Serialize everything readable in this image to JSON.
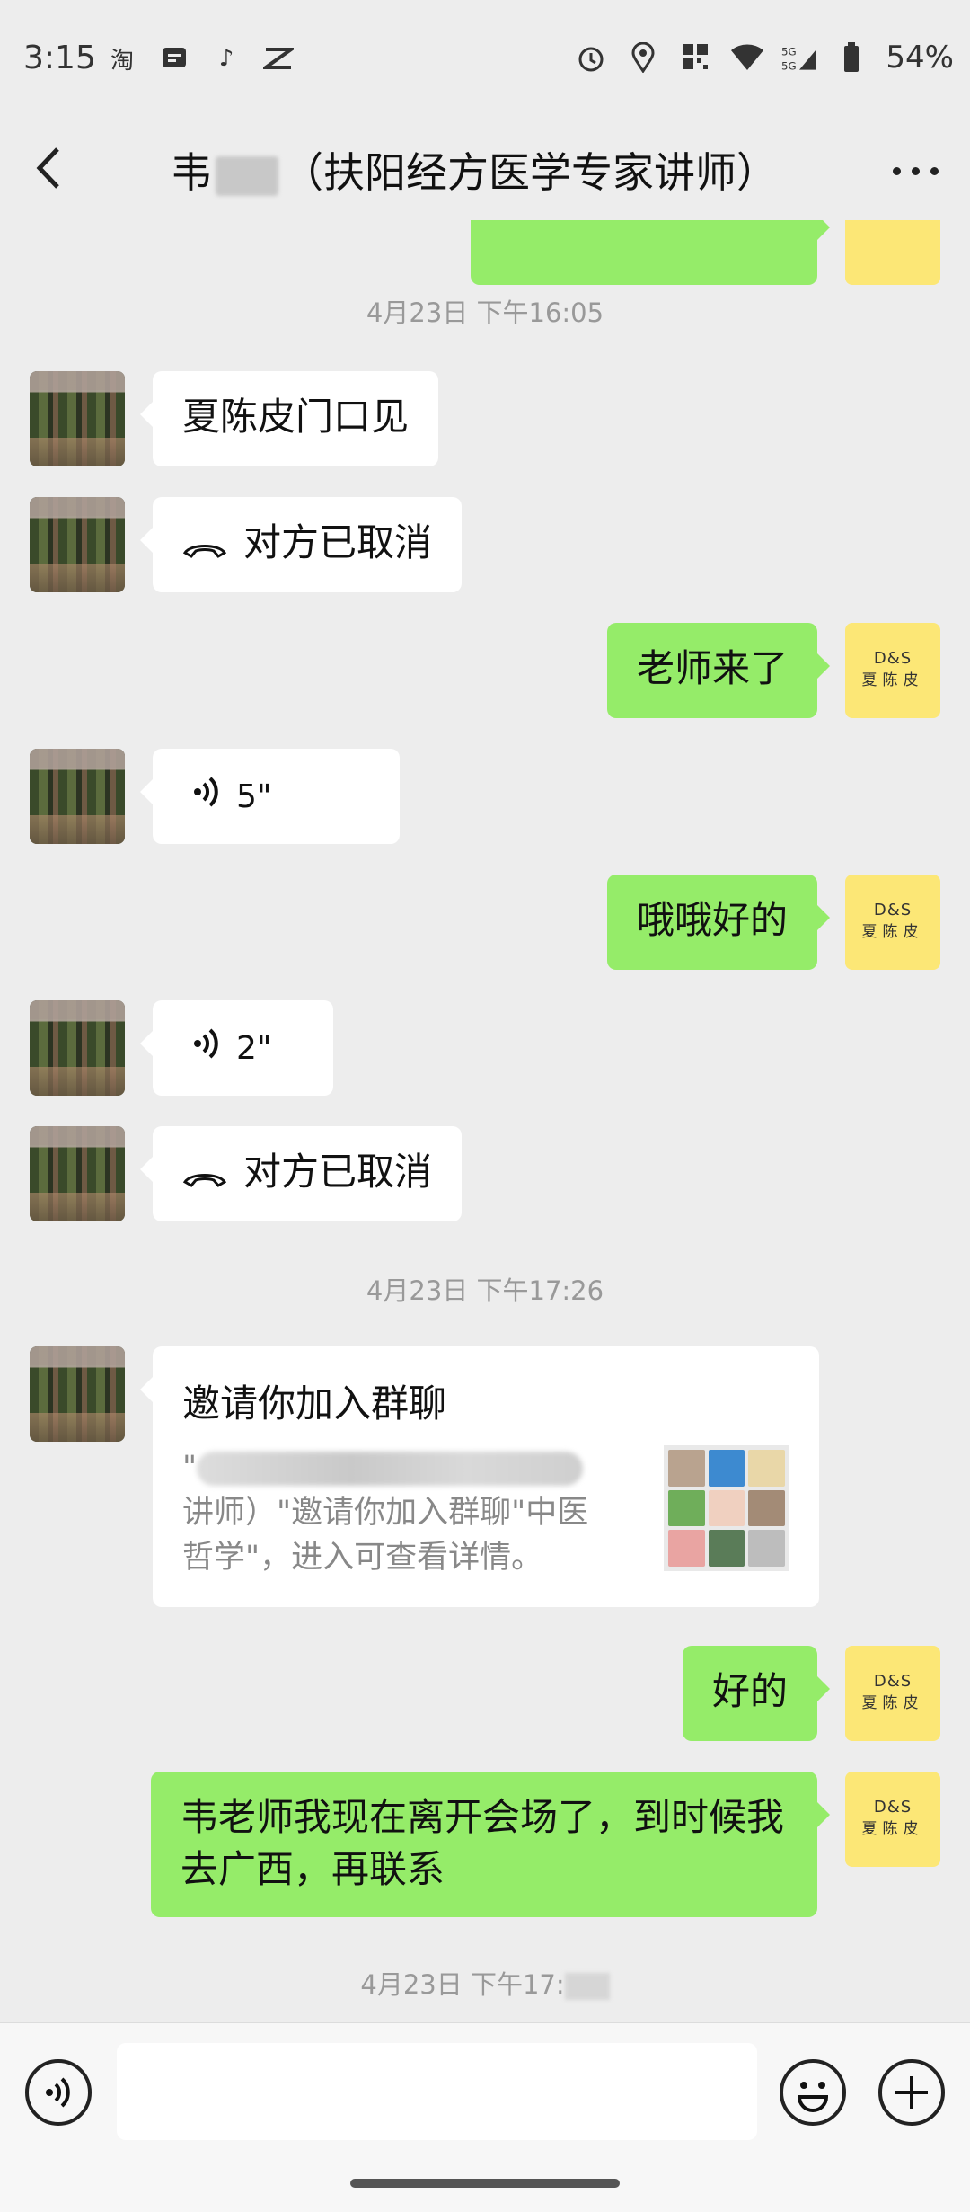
{
  "status_bar": {
    "time": "3:15",
    "apps": [
      "taobao-icon",
      "message-icon",
      "tiktok-icon",
      "capcut-icon"
    ],
    "network": "5G",
    "battery": "54%"
  },
  "nav": {
    "title_prefix": "韦",
    "title_suffix": "（扶阳经方医学专家讲师）"
  },
  "chat": {
    "timestamp_1": "4月23日 下午16:05",
    "msg_1": "夏陈皮门口见",
    "call_cancel_1": "对方已取消",
    "msg_2": "老师来了",
    "voice_1": "5\"",
    "msg_3": "哦哦好的",
    "voice_2": "2\"",
    "call_cancel_2": "对方已取消",
    "timestamp_2": "4月23日 下午17:26",
    "invite": {
      "title": "邀请你加入群聊",
      "desc_open_quote": "\"",
      "desc_rest": "讲师）\"邀请你加入群聊\"中医哲学\"，进入可查看详情。"
    },
    "msg_4": "好的",
    "msg_5": "韦老师我现在离开会场了，到时候我去广西，再联系",
    "timestamp_3": "4月23日 下午17:",
    "self_avatar": {
      "logo": "D&S",
      "name": "夏陈皮"
    }
  },
  "colors": {
    "background": "#ededed",
    "bubble_out": "#95ec69",
    "bubble_in": "#ffffff",
    "self_avatar": "#fce776"
  }
}
